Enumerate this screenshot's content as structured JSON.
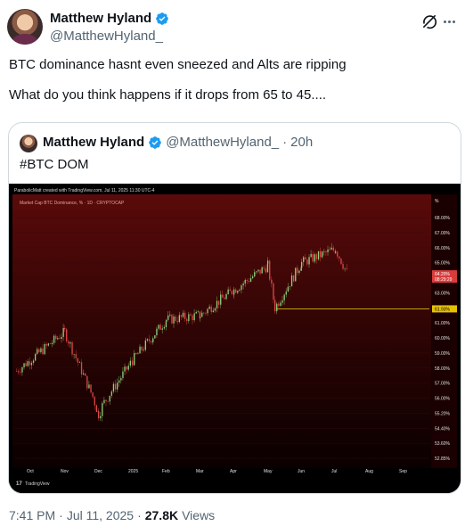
{
  "author": {
    "name": "Matthew Hyland",
    "handle": "@MatthewHyland_"
  },
  "tweet": {
    "line1": "BTC dominance hasnt even sneezed and Alts are ripping",
    "line2": "What do you think happens if it drops from 65 to 45...."
  },
  "quote": {
    "name": "Matthew Hyland",
    "handle": "@MatthewHyland_",
    "separator": "·",
    "time": "20h",
    "text": "#BTC DOM"
  },
  "chart_meta": {
    "credit": "ParabolicMatt created with TradingView.com, Jul 11, 2025 11:30 UTC-4",
    "symbol": "Market Cap BTC Dominance, % · 1D · CRYPTOCAP",
    "axis_unit": "%",
    "footer_logo": "TradingView",
    "current_price": "64.20%",
    "countdown": "08:29:29",
    "line_label": "61.93%"
  },
  "chart_data": {
    "type": "candlestick",
    "x_ticks": [
      "Oct",
      "Nov",
      "Dec",
      "2025",
      "Feb",
      "Mar",
      "Apr",
      "May",
      "Jun",
      "Jul",
      "Aug",
      "Sep"
    ],
    "y_ticks": [
      "68.00%",
      "67.00%",
      "66.00%",
      "65.00%",
      "64.00%",
      "63.00%",
      "62.00%",
      "61.00%",
      "60.00%",
      "59.00%",
      "58.00%",
      "57.00%",
      "56.00%",
      "55.20%",
      "54.40%",
      "53.60%",
      "52.85%"
    ],
    "horizontal_line": 61.93,
    "approx_path": [
      {
        "x": "Oct",
        "y": 57.8
      },
      {
        "x": "Nov",
        "y": 60.4
      },
      {
        "x": "Dec",
        "y": 55.2
      },
      {
        "x": "2025",
        "y": 58.5
      },
      {
        "x": "Feb",
        "y": 61.2
      },
      {
        "x": "Mar",
        "y": 61.5
      },
      {
        "x": "Apr",
        "y": 63.2
      },
      {
        "x": "May",
        "y": 64.8
      },
      {
        "x": "May",
        "y": 62.0
      },
      {
        "x": "Jun",
        "y": 65.0
      },
      {
        "x": "Jul",
        "y": 65.9
      },
      {
        "x": "Jul",
        "y": 64.2
      }
    ]
  },
  "footer": {
    "time": "7:41 PM",
    "dot1": "·",
    "date": "Jul 11, 2025",
    "dot2": "·",
    "views_count": "27.8K",
    "views_label": "Views"
  }
}
